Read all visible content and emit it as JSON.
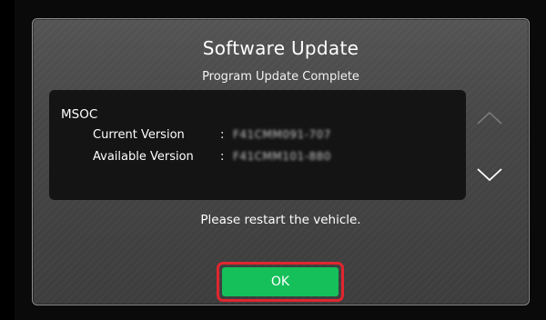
{
  "dialog": {
    "title": "Software Update",
    "subtitle": "Program Update Complete",
    "module_name": "MSOC",
    "current_version_label": "Current Version",
    "current_version_value": "F41CMM091-707",
    "available_version_label": "Available Version",
    "available_version_value": "F41CMM101-880",
    "separator": ":",
    "message": "Please restart the vehicle.",
    "ok_label": "OK"
  },
  "icons": {
    "scroll_up": "chevron-up-icon",
    "scroll_down": "chevron-down-icon"
  },
  "colors": {
    "ok_button": "#15c05a",
    "highlight_border": "#e0262f",
    "dialog_background": "#4a4a4a",
    "info_box": "#141414"
  }
}
